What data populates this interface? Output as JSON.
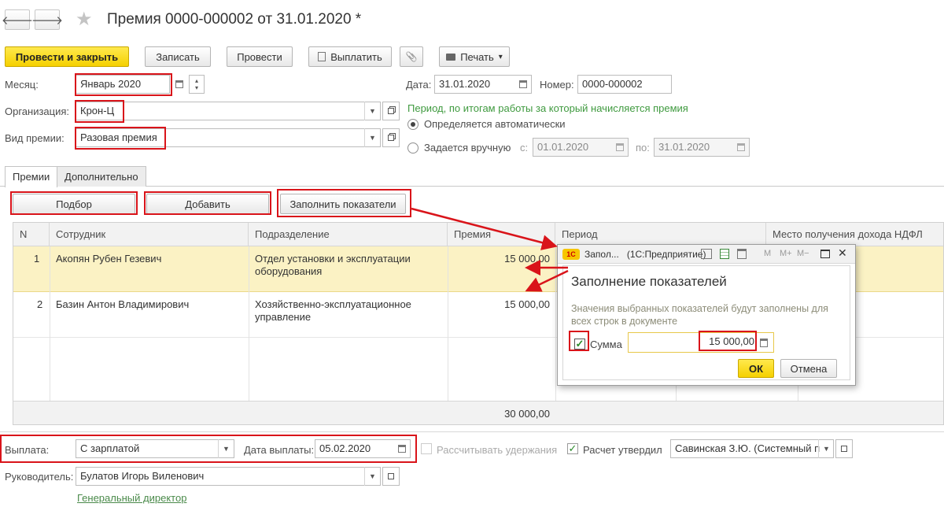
{
  "header": {
    "title": "Премия 0000-000002 от 31.01.2020 *",
    "back_glyph": "🡐",
    "forward_glyph": "🡒",
    "star_glyph": "★"
  },
  "toolbar": {
    "post_and_close": "Провести и закрыть",
    "save": "Записать",
    "post": "Провести",
    "pay": "Выплатить",
    "print": "Печать",
    "print_arrow": "▾",
    "attach_glyph": "📎"
  },
  "form": {
    "month_label": "Месяц:",
    "month_value": "Январь 2020",
    "org_label": "Организация:",
    "org_value": "Крон-Ц",
    "bonus_type_label": "Вид премии:",
    "bonus_type_value": "Разовая премия",
    "date_label": "Дата:",
    "date_value": "31.01.2020",
    "number_label": "Номер:",
    "number_value": "0000-000002",
    "period_caption": "Период, по итогам работы за который начисляется премия",
    "auto_label": "Определяется автоматически",
    "manual_label": "Задается вручную",
    "from_label": "с:",
    "from_value": "01.01.2020",
    "to_label": "по:",
    "to_value": "31.01.2020"
  },
  "tabs": [
    {
      "label": "Премии",
      "active": true
    },
    {
      "label": "Дополнительно",
      "active": false
    }
  ],
  "table_toolbar": {
    "select": "Подбор",
    "add": "Добавить",
    "fill": "Заполнить показатели"
  },
  "table": {
    "columns": [
      "N",
      "Сотрудник",
      "Подразделение",
      "Премия",
      "Период",
      "Место получения дохода НДФЛ"
    ],
    "rows": [
      {
        "n": "1",
        "employee": "Акопян Рубен Гезевич",
        "dept_line1": "Отдел установки и эксплуатации",
        "dept_line2": "оборудования",
        "bonus": "15 000,00"
      },
      {
        "n": "2",
        "employee": "Базин Антон Владимирович",
        "dept_line1": "Хозяйственно-эксплуатационное",
        "dept_line2": "управление",
        "bonus": "15 000,00"
      }
    ],
    "total_bonus": "30 000,00"
  },
  "dialog": {
    "window_title": "Запол...   (1С:Предприятие)",
    "logo": "1C",
    "heading": "Заполнение показателей",
    "description": "Значения выбранных показателей будут заполнены для всех строк в документе",
    "sum_label": "Сумма",
    "sum_value": "15 000,00",
    "ok": "ОК",
    "cancel": "Отмена",
    "m_labels": [
      "M",
      "M+",
      "M−"
    ],
    "close_glyph": "✕"
  },
  "footer": {
    "payment_label": "Выплата:",
    "payment_value": "С зарплатой",
    "pay_date_label": "Дата выплаты:",
    "pay_date_value": "05.02.2020",
    "withhold_label": "Рассчитывать удержания",
    "approved_label": "Расчет утвердил",
    "approved_value": "Савинская З.Ю. (Системный п",
    "head_label": "Руководитель:",
    "head_value": "Булатов Игорь Виленович",
    "head_position": "Генеральный директор"
  },
  "colors": {
    "accent_yellow": "#f5d000",
    "highlight_row": "#fbf2c4",
    "annotation_red": "#d9141a",
    "caption_green": "#3f9a3f"
  }
}
